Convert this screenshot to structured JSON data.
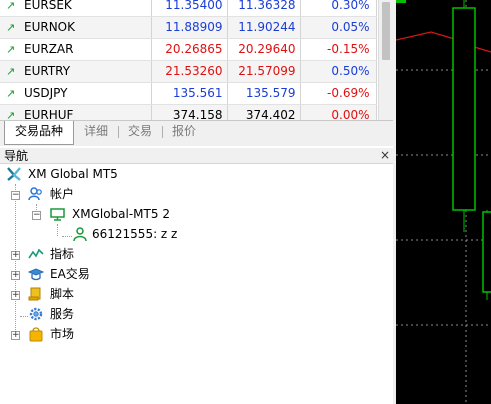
{
  "market_watch": {
    "rows": [
      {
        "symbol": "EURSEK",
        "bid": "11.35400",
        "ask": "11.36328",
        "change": "0.30%",
        "dir": "up"
      },
      {
        "symbol": "EURNOK",
        "bid": "11.88909",
        "ask": "11.90244",
        "change": "0.05%",
        "dir": "up"
      },
      {
        "symbol": "EURZAR",
        "bid": "20.26865",
        "ask": "20.29640",
        "change": "-0.15%",
        "dir": "down"
      },
      {
        "symbol": "EURTRY",
        "bid": "21.53260",
        "ask": "21.57099",
        "change": "0.50%",
        "dir": "down"
      },
      {
        "symbol": "USDJPY",
        "bid": "135.561",
        "ask": "135.579",
        "change": "-0.69%",
        "dir": "up"
      }
    ],
    "partial_bottom": {
      "symbol": "EURHUF",
      "bid": "374.158",
      "ask": "374.402",
      "change": "0.00%"
    }
  },
  "tabs": [
    {
      "label": "交易品种",
      "active": true
    },
    {
      "label": "详细",
      "active": false
    },
    {
      "label": "交易",
      "active": false
    },
    {
      "label": "报价",
      "active": false
    }
  ],
  "navigator": {
    "title": "导航",
    "close": "×",
    "root": "XM Global MT5",
    "accounts_label": "帐户",
    "server": "XMGlobal-MT5 2",
    "account": "66121555: z z",
    "indicators": "指标",
    "ea": "EA交易",
    "scripts": "脚本",
    "services": "服务",
    "market": "市场"
  },
  "colors": {
    "up": "#1a3dd6",
    "down": "#e01010",
    "arrow_green": "#169c2e",
    "candle_green": "#00c000",
    "chart_bg": "#000000"
  }
}
